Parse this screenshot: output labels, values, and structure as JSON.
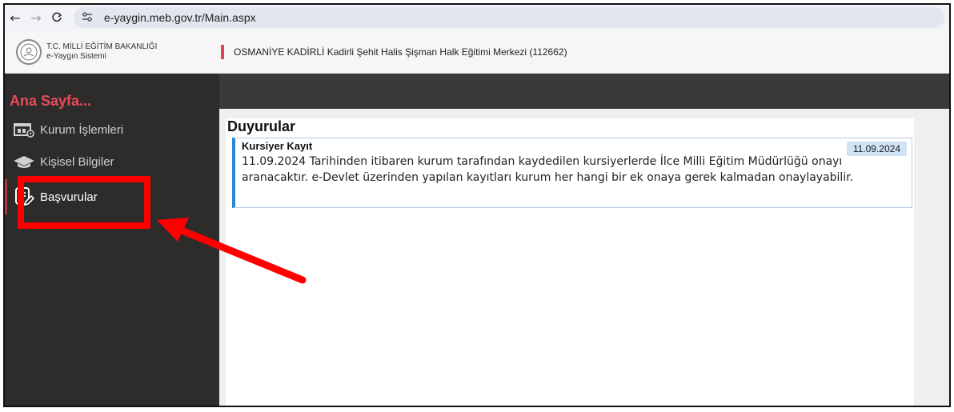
{
  "browser": {
    "back_glyph": "←",
    "forward_glyph": "→",
    "reload_glyph": "C",
    "site_info_glyph": "⚙",
    "url": "e-yaygin.meb.gov.tr/Main.aspx"
  },
  "header": {
    "ministry_name": "T.C. MİLLİ EĞİTİM BAKANLIĞI",
    "system_name": "e-Yaygın Sistemi",
    "institution": "OSMANİYE KADİRLİ Kadirli Şehit Halis Şişman Halk Eğitimi Merkezi (112662)"
  },
  "sidebar": {
    "home_title": "Ana Sayfa...",
    "items": [
      {
        "label": "Kurum İşlemleri",
        "icon": "institution-settings-icon"
      },
      {
        "label": "Kişisel Bilgiler",
        "icon": "graduation-cap-icon"
      },
      {
        "label": "Başvurular",
        "icon": "edit-document-icon"
      }
    ]
  },
  "main": {
    "panel_title": "Duyurular",
    "announcements": [
      {
        "title": "Kursiyer Kayıt",
        "date": "11.09.2024",
        "body": "11.09.2024 Tarihinden itibaren kurum tarafından kaydedilen kursiyerlerde İlce Milli Eğitim Müdürlüğü onayı aranacaktır. e-Devlet üzerinden yapılan kayıtları kurum her hangi bir ek onaya gerek kalmadan onaylayabilir."
      }
    ]
  },
  "colors": {
    "accent": "#e84b57",
    "sidebar_bg": "#2e2b2b",
    "annotation_red": "#ff0000",
    "announcement_border": "#2d88d6"
  }
}
